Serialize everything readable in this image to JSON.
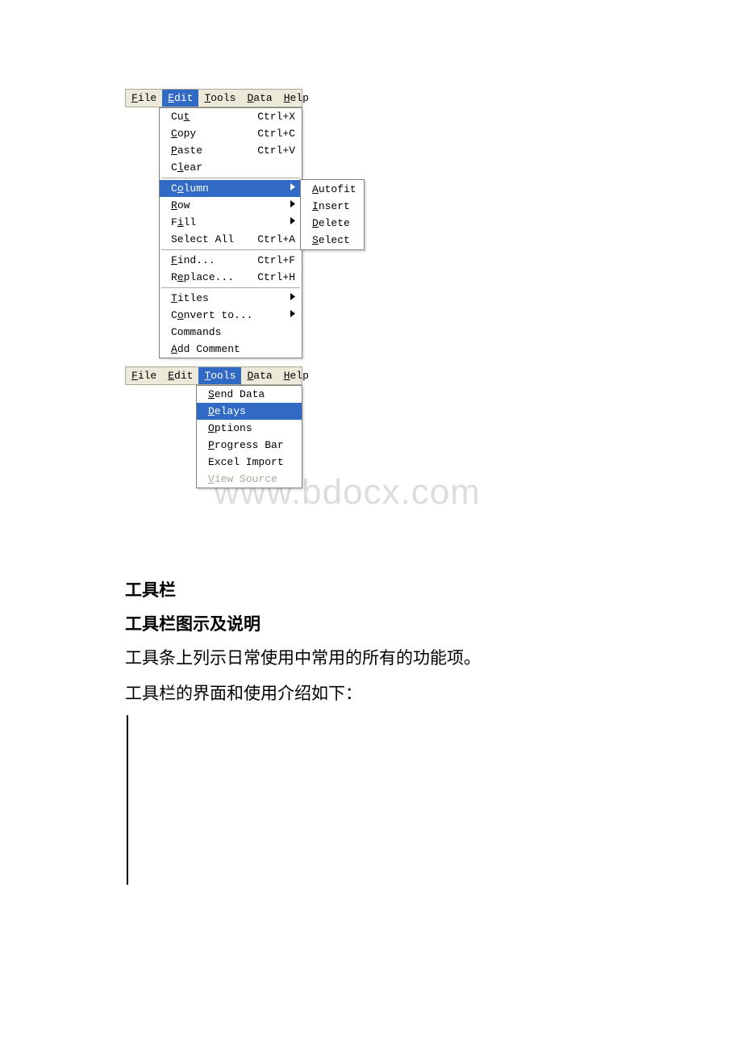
{
  "menubar1": {
    "file": "File",
    "edit": "Edit",
    "tools": "Tools",
    "data": "Data",
    "help": "Help"
  },
  "editMenu": {
    "cut": {
      "label": "Cut",
      "shortcut": "Ctrl+X"
    },
    "copy": {
      "label": "Copy",
      "shortcut": "Ctrl+C"
    },
    "paste": {
      "label": "Paste",
      "shortcut": "Ctrl+V"
    },
    "clear": {
      "label": "Clear"
    },
    "column": {
      "label": "Column"
    },
    "row": {
      "label": "Row"
    },
    "fill": {
      "label": "Fill"
    },
    "selectAll": {
      "label": "Select All",
      "shortcut": "Ctrl+A"
    },
    "find": {
      "label": "Find...",
      "shortcut": "Ctrl+F"
    },
    "replace": {
      "label": "Replace...",
      "shortcut": "Ctrl+H"
    },
    "titles": {
      "label": "Titles"
    },
    "convert": {
      "label": "Convert to..."
    },
    "commands": {
      "label": "Commands"
    },
    "addComment": {
      "label": "Add Comment"
    }
  },
  "columnSubmenu": {
    "autofit": "Autofit",
    "insert": "Insert",
    "delete": "Delete",
    "select": "Select"
  },
  "menubar2": {
    "file": "File",
    "edit": "Edit",
    "tools": "Tools",
    "data": "Data",
    "help": "Help"
  },
  "toolsMenu": {
    "sendData": "Send Data",
    "delays": "Delays",
    "options": "Options",
    "progressBar": "Progress Bar",
    "excelImport": "Excel Import",
    "viewSource": "View Source"
  },
  "watermark": "www.bdocx.com",
  "text": {
    "heading1": "工具栏",
    "heading2": "工具栏图示及说明",
    "para1": "工具条上列示日常使用中常用的所有的功能项。",
    "para2": "工具栏的界面和使用介绍如下："
  }
}
